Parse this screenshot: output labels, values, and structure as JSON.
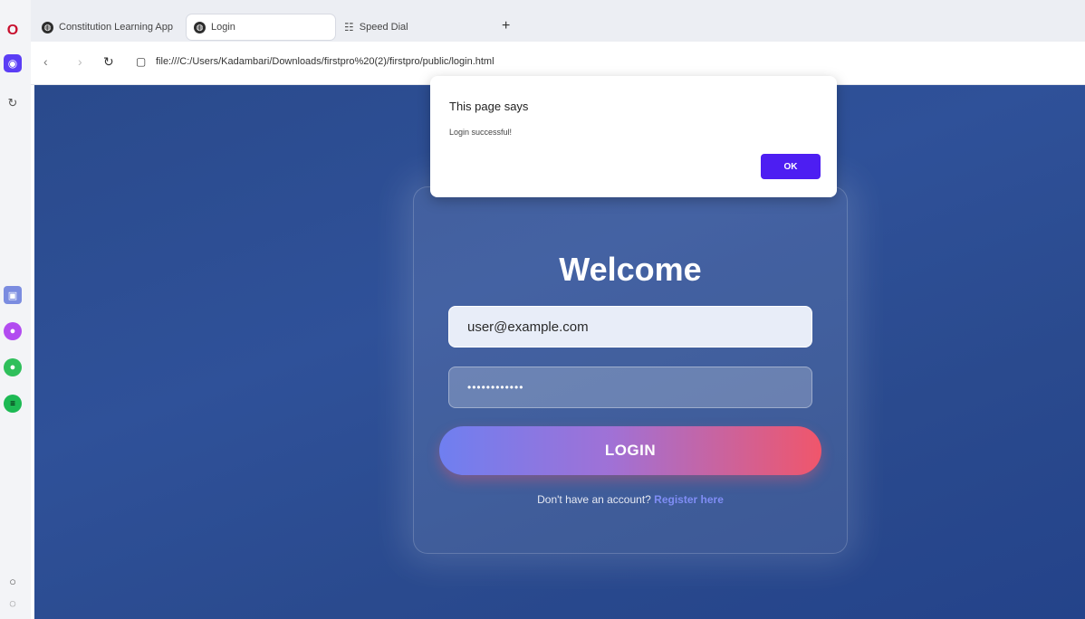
{
  "browser": {
    "tabs": [
      {
        "label": "Constitution Learning App"
      },
      {
        "label": "Login"
      },
      {
        "label": "Speed Dial"
      }
    ],
    "new_tab_label": "+",
    "url": "file:///C:/Users/Kadambari/Downloads/firstpro%20(2)/firstpro/public/login.html"
  },
  "sidebar": {
    "icons": [
      "opera-logo-icon",
      "aria-icon",
      "history-icon",
      "app-icon",
      "messenger-icon",
      "whatsapp-icon",
      "spotify-icon",
      "settings-icon",
      "more-icon"
    ]
  },
  "login": {
    "title": "Welcome",
    "email_value": "user@example.com",
    "password_value": "••••••••••••",
    "button_label": "LOGIN",
    "register_prompt": "Don't have an account?",
    "register_link": "Register here"
  },
  "dialog": {
    "title": "This page says",
    "message": "Login successful!",
    "ok_label": "OK"
  },
  "colors": {
    "background": "#2f5199",
    "button_gradient_start": "#6f7ff0",
    "button_gradient_end": "#f0566b",
    "dialog_ok": "#4d1ef2",
    "link": "#7f8df5"
  }
}
